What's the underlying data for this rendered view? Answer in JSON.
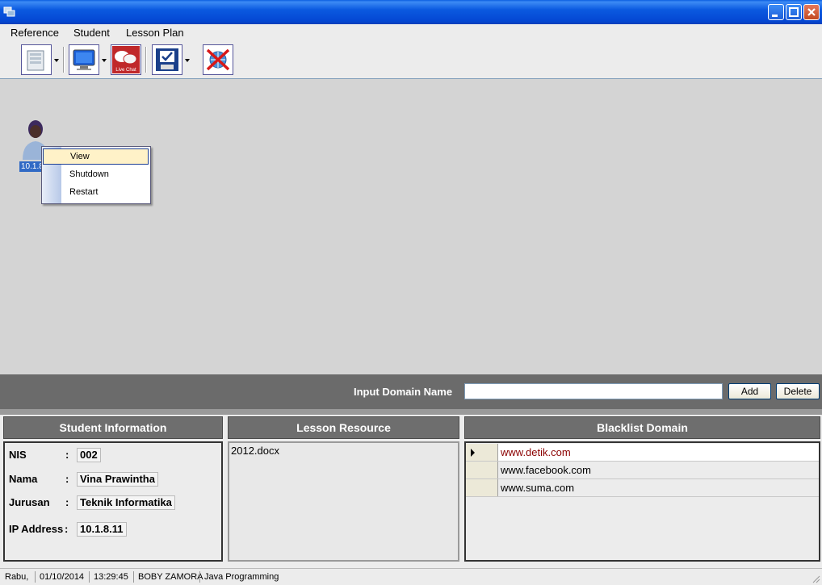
{
  "window": {
    "title": ""
  },
  "menu": {
    "items": [
      "Reference",
      "Student",
      "Lesson Plan"
    ]
  },
  "toolbar": {
    "buttons": [
      "server-icon",
      "monitor-icon",
      "live-chat-icon",
      "checklist-icon",
      "blocked-internet-icon"
    ],
    "live_chat_label": "Live Chat"
  },
  "workspace": {
    "student_node_label": "10.1.8",
    "context_menu": [
      "View",
      "Shutdown",
      "Restart"
    ]
  },
  "domain_input": {
    "label": "Input Domain Name",
    "value": "",
    "add_label": "Add",
    "delete_label": "Delete"
  },
  "panels": {
    "student_info": {
      "title": "Student Information",
      "fields": [
        {
          "label": "NIS",
          "value": "002"
        },
        {
          "label": "Nama",
          "value": "Vina Prawintha"
        },
        {
          "label": "Jurusan",
          "value": "Teknik Informatika"
        },
        {
          "label": "IP Address",
          "value": "10.1.8.11"
        }
      ],
      "separator": ":"
    },
    "lesson_resource": {
      "title": "Lesson Resource",
      "items": [
        "2012.docx"
      ]
    },
    "blacklist": {
      "title": "Blacklist Domain",
      "rows": [
        "www.detik.com",
        "www.facebook.com",
        "www.suma.com"
      ],
      "selected_color": "#8b0000"
    }
  },
  "status": {
    "day": "Rabu,",
    "date": "01/10/2014",
    "time": "13:29:45",
    "user": "BOBY ZAMORA",
    "subject": "Java Programming"
  },
  "colors": {
    "titlebar": "#0b5ae0",
    "highlight": "#316ac5",
    "band": "#6b6b6b"
  }
}
